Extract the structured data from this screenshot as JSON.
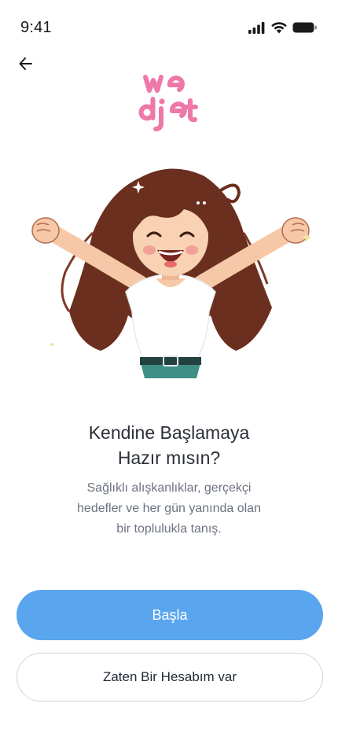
{
  "status_bar": {
    "time": "9:41",
    "icons": [
      "signal-icon",
      "wifi-icon",
      "battery-icon"
    ]
  },
  "header": {
    "back_icon": "arrow-left-icon"
  },
  "logo": {
    "line1": "we",
    "line2": "diet",
    "color": "#ee78a8"
  },
  "hero": {
    "illustration": "cheering-girl-illustration"
  },
  "content": {
    "headline_line1": "Kendine Başlamaya",
    "headline_line2": "Hazır mısın?",
    "subtitle_line1": "Sağlıklı alışkanlıklar, gerçekçi",
    "subtitle_line2": "hedefler ve her gün yanında olan",
    "subtitle_line3": "bir toplulukla tanış."
  },
  "actions": {
    "primary_label": "Başla",
    "secondary_label": "Zaten Bir Hesabım var"
  },
  "colors": {
    "accent": "#59a5ee",
    "brand_pink": "#ee78a8",
    "text_dark": "#2b2f38",
    "text_muted": "#6b7280"
  }
}
